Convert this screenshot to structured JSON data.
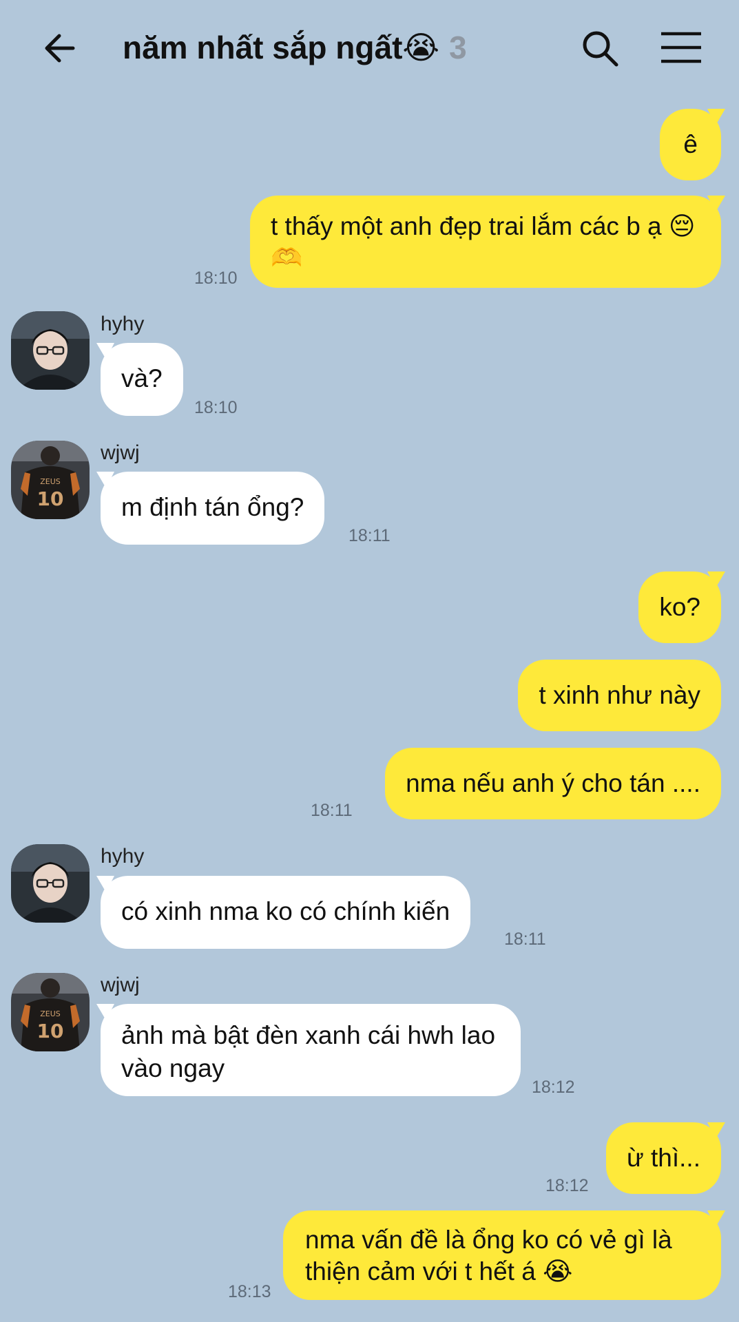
{
  "header": {
    "title": "năm nhất sắp ngất😭",
    "member_count": "3"
  },
  "messages": [
    {
      "type": "out",
      "text": "ê"
    },
    {
      "type": "out",
      "text": "t thấy một anh đẹp trai lắm các b ạ 😔🫶",
      "time": "18:10"
    },
    {
      "type": "in",
      "sender": "hyhy",
      "text": "và?",
      "time": "18:10"
    },
    {
      "type": "in",
      "sender": "wjwj",
      "text": "m định tán ổng?",
      "time": "18:11"
    },
    {
      "type": "out",
      "text": "ko?"
    },
    {
      "type": "out",
      "text": "t xinh như này"
    },
    {
      "type": "out",
      "text": "nma nếu anh ý cho tán ....",
      "time": "18:11"
    },
    {
      "type": "in",
      "sender": "hyhy",
      "text": "có xinh nma ko có chính kiến",
      "time": "18:11"
    },
    {
      "type": "in",
      "sender": "wjwj",
      "text": "ảnh mà bật đèn xanh cái hwh lao vào ngay",
      "time": "18:12"
    },
    {
      "type": "out",
      "text": "ừ thì...",
      "time": "18:12"
    },
    {
      "type": "out",
      "text": "nma vấn đề là ổng ko có vẻ gì là thiện cảm với t hết á 😭",
      "time": "18:13"
    }
  ],
  "avatars": {
    "hyhy": {
      "icon": "person-glasses-avatar",
      "colors": [
        "#1c2226",
        "#e8d3c6"
      ]
    },
    "wjwj": {
      "icon": "jersey-10-zeus-avatar",
      "colors": [
        "#1d1a18",
        "#d0a270"
      ]
    }
  },
  "colors": {
    "background": "#b2c7da",
    "outgoing_bubble": "#fee93a",
    "incoming_bubble": "#ffffff"
  }
}
